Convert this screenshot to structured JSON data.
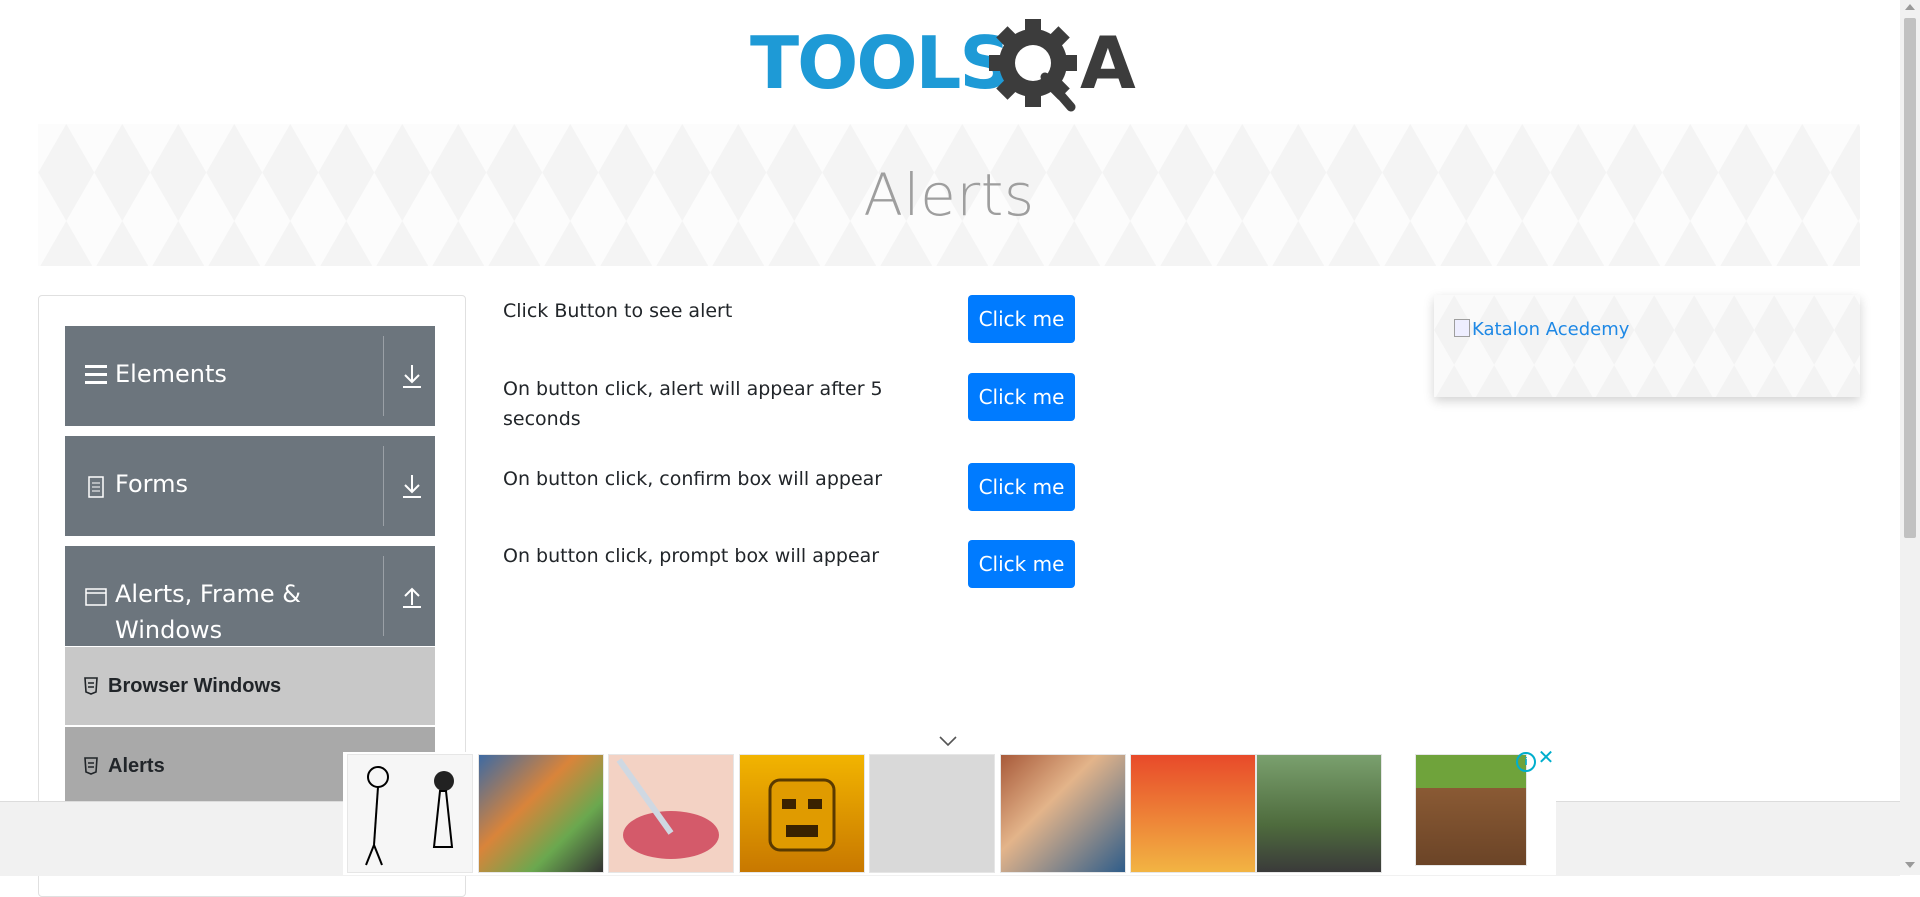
{
  "logo": {
    "text_left": "TOOLS",
    "text_right": "A"
  },
  "banner": {
    "title": "Alerts"
  },
  "sidebar": {
    "groups": [
      {
        "label": "Elements",
        "icon": "hamburger-icon",
        "arrow": "download-icon"
      },
      {
        "label": "Forms",
        "icon": "document-icon",
        "arrow": "download-icon"
      },
      {
        "label_line1": "Alerts, Frame &",
        "label_line2": "Windows",
        "icon": "window-icon",
        "arrow": "upload-icon"
      }
    ],
    "items": [
      {
        "label": "Browser Windows",
        "icon": "list-icon"
      },
      {
        "label": "Alerts",
        "icon": "list-icon"
      }
    ]
  },
  "main": {
    "rows": [
      {
        "text": "Click Button to see alert",
        "button": "Click me"
      },
      {
        "text_line1": "On button click, alert will appear after 5",
        "text_line2": "seconds",
        "button": "Click me"
      },
      {
        "text": "On button click, confirm box will appear",
        "button": "Click me"
      },
      {
        "text": "On button click, prompt box will appear",
        "button": "Click me"
      }
    ]
  },
  "right_ad": {
    "link_text": "Katalon Acedemy"
  },
  "ads": {
    "thumbs": [
      {
        "name": "comic-couple"
      },
      {
        "name": "grand-theft-auto-v-cover"
      },
      {
        "name": "lip-filler"
      },
      {
        "name": "temple-run"
      },
      {
        "name": "whack-your-neighbour"
      },
      {
        "name": "grand-theft-auto-v"
      },
      {
        "name": "papas-cheeseria"
      },
      {
        "name": "soldier-game"
      },
      {
        "name": "minecraft"
      }
    ]
  },
  "colors": {
    "primary_button": "#007bff",
    "sidebar_group": "#6c757d",
    "logo_blue": "#1e9ad6",
    "logo_dark": "#3c3c3c"
  }
}
